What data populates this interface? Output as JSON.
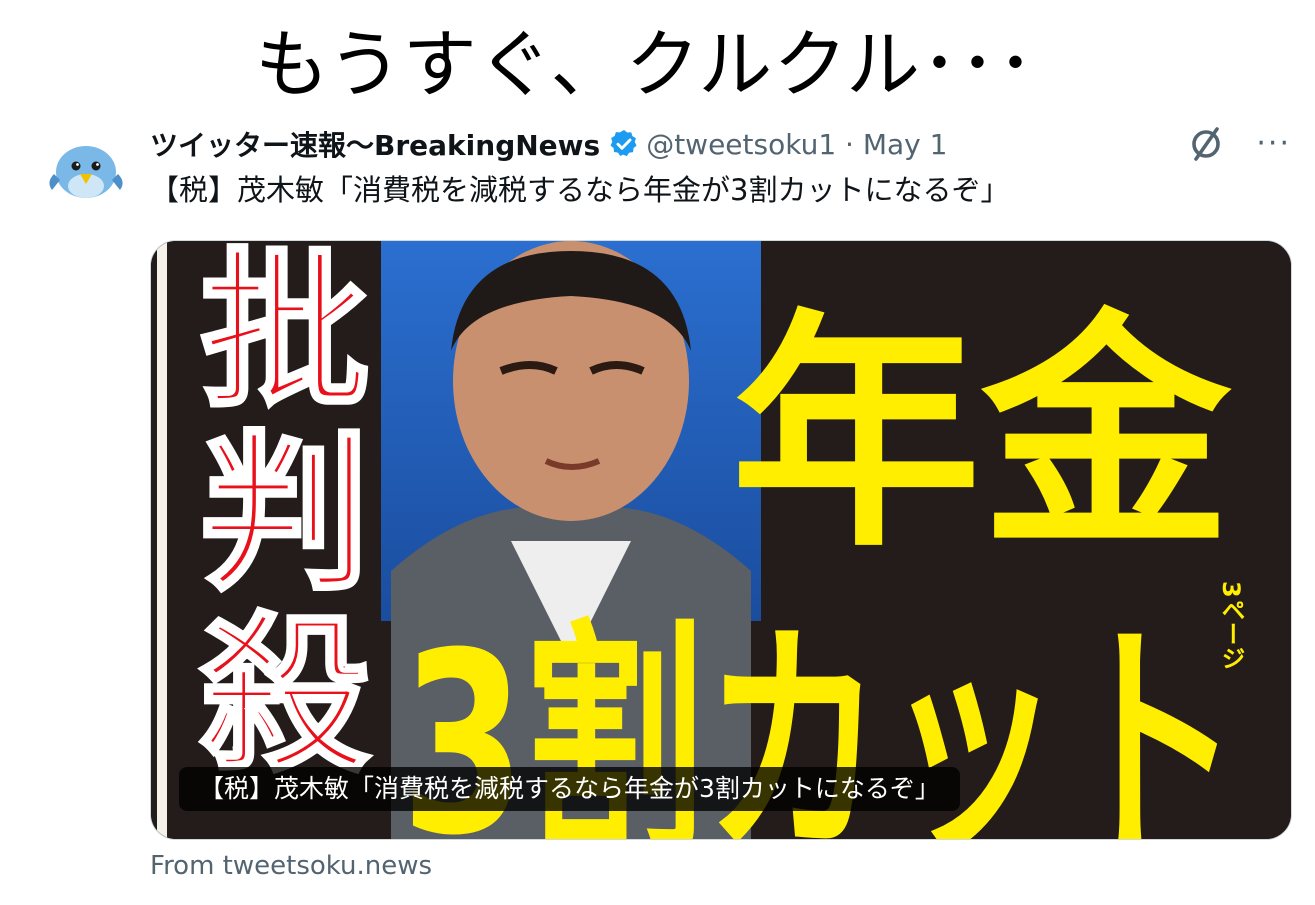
{
  "caption": "もうすぐ、クルクル･･･",
  "tweet": {
    "display_name": "ツイッター速報〜BreakingNews",
    "handle_date": "@tweetsoku1 · May 1",
    "text": "【税】茂木敏「消費税を減税するなら年金が3割カットになるぞ」",
    "more": "···",
    "icons": {
      "avatar": "bird-avatar",
      "verified": "verified-badge-icon",
      "grok": "grok-icon",
      "more": "more-icon"
    }
  },
  "card": {
    "caption": "【税】茂木敏「消費税を減税するなら年金が3割カットになるぞ」",
    "headline_left": "批判殺",
    "headline_top": "年金",
    "headline_bottom": "3割カット",
    "page_ref": "3ページ",
    "source": "From tweetsoku.news"
  },
  "colors": {
    "accent": "#1d9bf0",
    "headline_yellow": "#ffee00",
    "headline_red": "#e8101b"
  }
}
